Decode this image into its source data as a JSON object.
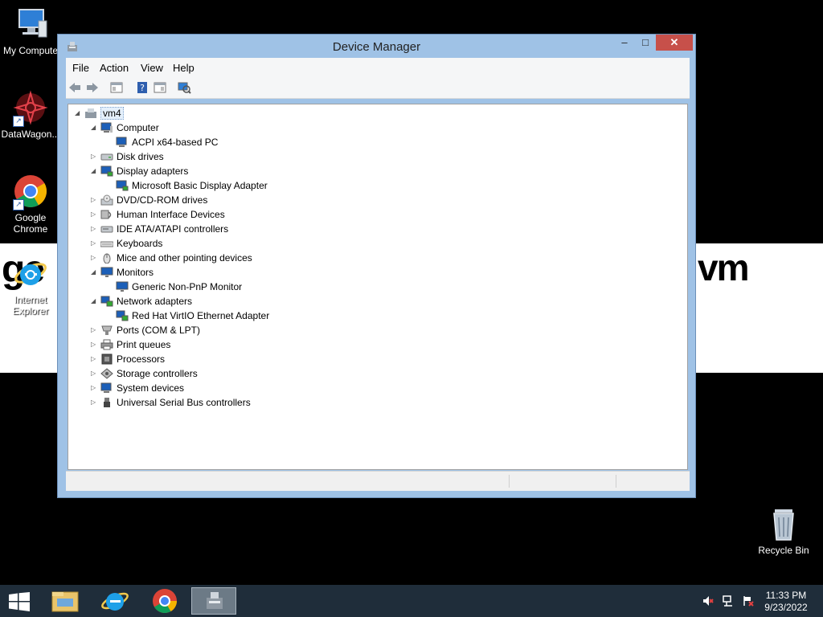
{
  "desktop": {
    "wallpaper_left": "ge",
    "wallpaper_right": "vm",
    "icons": [
      {
        "label_1": "My Computer",
        "label_2": ""
      },
      {
        "label_1": "DataWagon...",
        "label_2": ""
      },
      {
        "label_1": "Google",
        "label_2": "Chrome"
      },
      {
        "label_1": "Internet",
        "label_2": "Explorer"
      },
      {
        "label_1": "Recycle Bin",
        "label_2": ""
      }
    ]
  },
  "window": {
    "title": "Device Manager",
    "minimize": "–",
    "maximize": "□",
    "close": "✕",
    "menu": [
      "File",
      "Action",
      "View",
      "Help"
    ]
  },
  "tree": [
    {
      "label": "vm4",
      "level": 0,
      "toggle": "◢",
      "icon": "computer-root-icon"
    },
    {
      "label": "Computer",
      "level": 1,
      "toggle": "◢",
      "icon": "computer-icon"
    },
    {
      "label": "ACPI x64-based PC",
      "level": 2,
      "toggle": "",
      "icon": "computer-icon"
    },
    {
      "label": "Disk drives",
      "level": 1,
      "toggle": "▷",
      "icon": "disk-drive-icon"
    },
    {
      "label": "Display adapters",
      "level": 1,
      "toggle": "◢",
      "icon": "display-adapter-icon"
    },
    {
      "label": "Microsoft Basic Display Adapter",
      "level": 2,
      "toggle": "",
      "icon": "display-adapter-icon"
    },
    {
      "label": "DVD/CD-ROM drives",
      "level": 1,
      "toggle": "▷",
      "icon": "dvd-drive-icon"
    },
    {
      "label": "Human Interface Devices",
      "level": 1,
      "toggle": "▷",
      "icon": "hid-icon"
    },
    {
      "label": "IDE ATA/ATAPI controllers",
      "level": 1,
      "toggle": "▷",
      "icon": "ide-controller-icon"
    },
    {
      "label": "Keyboards",
      "level": 1,
      "toggle": "▷",
      "icon": "keyboard-icon"
    },
    {
      "label": "Mice and other pointing devices",
      "level": 1,
      "toggle": "▷",
      "icon": "mouse-icon"
    },
    {
      "label": "Monitors",
      "level": 1,
      "toggle": "◢",
      "icon": "monitor-icon"
    },
    {
      "label": "Generic Non-PnP Monitor",
      "level": 2,
      "toggle": "",
      "icon": "monitor-icon"
    },
    {
      "label": "Network adapters",
      "level": 1,
      "toggle": "◢",
      "icon": "network-adapter-icon"
    },
    {
      "label": "Red Hat VirtIO Ethernet Adapter",
      "level": 2,
      "toggle": "",
      "icon": "network-adapter-icon"
    },
    {
      "label": "Ports (COM & LPT)",
      "level": 1,
      "toggle": "▷",
      "icon": "port-icon"
    },
    {
      "label": "Print queues",
      "level": 1,
      "toggle": "▷",
      "icon": "printer-icon"
    },
    {
      "label": "Processors",
      "level": 1,
      "toggle": "▷",
      "icon": "processor-icon"
    },
    {
      "label": "Storage controllers",
      "level": 1,
      "toggle": "▷",
      "icon": "storage-controller-icon"
    },
    {
      "label": "System devices",
      "level": 1,
      "toggle": "▷",
      "icon": "system-device-icon"
    },
    {
      "label": "Universal Serial Bus controllers",
      "level": 1,
      "toggle": "▷",
      "icon": "usb-controller-icon"
    }
  ],
  "taskbar": {
    "clock_time": "11:33 PM",
    "clock_date": "9/23/2022"
  }
}
